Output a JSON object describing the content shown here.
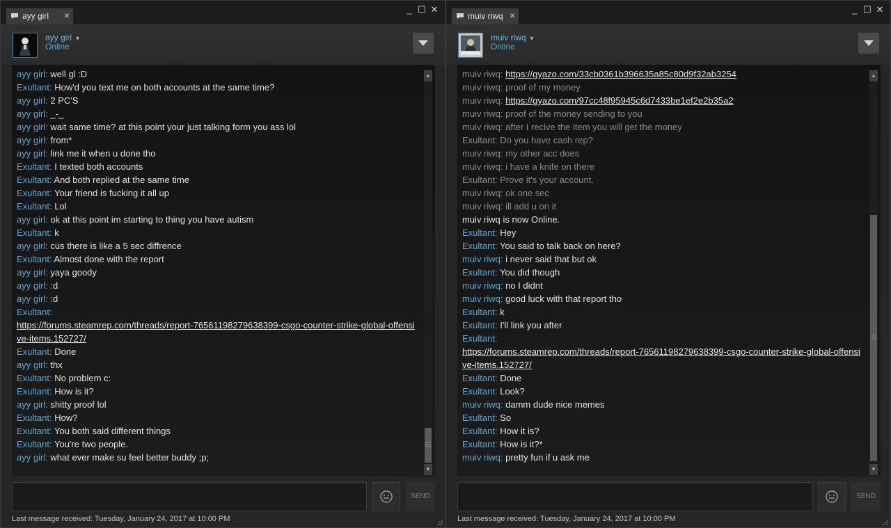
{
  "colors": {
    "accent": "#5aa9d8",
    "window_bg": "#262626",
    "chat_bg": "#141414",
    "old_message": "#8a8a8a"
  },
  "icons": {
    "tab": "chat-bubble-icon",
    "close": "close-icon",
    "minimize": "minimize-icon",
    "maximize": "maximize-icon",
    "menu": "chevron-down-icon",
    "emoji": "emoji-icon",
    "resize": "resize-grip-icon"
  },
  "left": {
    "tab_label": "ayy girl",
    "friend_name": "ayy girl",
    "friend_status": "Online",
    "send_label": "SEND",
    "footer": "Last message received: Tuesday, January 24, 2017 at 10:00 PM",
    "scroll_position": 1.0,
    "messages": [
      {
        "sender": "ayy girl",
        "text": "well gl :D"
      },
      {
        "sender": "Exultant",
        "text": "How'd you text me on both accounts at the same time?"
      },
      {
        "sender": "ayy girl",
        "text": "2 PC'S"
      },
      {
        "sender": "ayy girl",
        "text": "_-_"
      },
      {
        "sender": "ayy girl",
        "text": "wait same time? at this point your just talking form you ass lol"
      },
      {
        "sender": "ayy girl",
        "text": "from*"
      },
      {
        "sender": "ayy girl",
        "text": "link me it when u done tho"
      },
      {
        "sender": "Exultant",
        "text": "I texted both accounts"
      },
      {
        "sender": "Exultant",
        "text": "And both replied at the same time"
      },
      {
        "sender": "Exultant",
        "text": "Your friend is fucking it all up"
      },
      {
        "sender": "Exultant",
        "text": "Lol"
      },
      {
        "sender": "ayy girl",
        "text": "ok  at this point im starting to thing you have autism"
      },
      {
        "sender": "Exultant",
        "text": "k"
      },
      {
        "sender": "ayy girl",
        "text": "cus there is like a 5 sec diffrence"
      },
      {
        "sender": "Exultant",
        "text": "Almost done with the report"
      },
      {
        "sender": "ayy girl",
        "text": "yaya goody"
      },
      {
        "sender": "ayy girl",
        "text": ":d"
      },
      {
        "sender": "ayy girl",
        "text": ":d"
      },
      {
        "sender": "Exultant",
        "text": "",
        "link": "https://forums.steamrep.com/threads/report-76561198279638399-csgo-counter-strike-global-offensive-items.152727/"
      },
      {
        "sender": "Exultant",
        "text": "Done"
      },
      {
        "sender": "ayy girl",
        "text": "thx"
      },
      {
        "sender": "Exultant",
        "text": "No problem c:"
      },
      {
        "sender": "Exultant",
        "text": "How is it?"
      },
      {
        "sender": "ayy girl",
        "text": "shitty proof lol"
      },
      {
        "sender": "Exultant",
        "text": "How?"
      },
      {
        "sender": "Exultant",
        "text": "You both said different things"
      },
      {
        "sender": "Exultant",
        "text": "You're two people."
      },
      {
        "sender": "ayy girl",
        "text": "what ever make su feel better buddy ;p;"
      }
    ]
  },
  "right": {
    "tab_label": "muiv riwq",
    "friend_name": "muiv riwq",
    "friend_status": "Online",
    "send_label": "SEND",
    "footer": "Last message received: Tuesday, January 24, 2017 at 10:00 PM",
    "scroll_position": 1.0,
    "messages": [
      {
        "sender": "muiv riwq",
        "text": "",
        "link": "https://gyazo.com/33cb0361b396635a85c80d9f32ab3254",
        "old": true
      },
      {
        "sender": "muiv riwq",
        "text": "proof of my money",
        "old": true
      },
      {
        "sender": "muiv riwq",
        "text": "",
        "link": "https://gyazo.com/97cc48f95945c6d7433be1ef2e2b35a2",
        "old": true
      },
      {
        "sender": "muiv riwq",
        "text": "proof of the money sending to you",
        "old": true
      },
      {
        "sender": "muiv riwq",
        "text": "after I recive the item you will get the money",
        "old": true
      },
      {
        "sender": "Exultant",
        "text": "Do you have cash rep?",
        "old": true
      },
      {
        "sender": "muiv riwq",
        "text": "my other acc does",
        "old": true
      },
      {
        "sender": "muiv riwq",
        "text": "i have a knife on there",
        "old": true
      },
      {
        "sender": "Exultant",
        "text": "Prove it's your account.",
        "old": true
      },
      {
        "sender": "muiv riwq",
        "text": "ok one sec",
        "old": true
      },
      {
        "sender": "muiv riwq",
        "text": "ill add u on it",
        "old": true
      },
      {
        "status": "muiv riwq is now Online."
      },
      {
        "sender": "Exultant",
        "text": "Hey"
      },
      {
        "sender": "Exultant",
        "text": "You said to talk back on here?"
      },
      {
        "sender": "muiv riwq",
        "text": "i never said that but ok"
      },
      {
        "sender": "Exultant",
        "text": "You did though"
      },
      {
        "sender": "muiv riwq",
        "text": "no I didnt"
      },
      {
        "sender": "muiv riwq",
        "text": "good luck with that report tho"
      },
      {
        "sender": "Exultant",
        "text": "k"
      },
      {
        "sender": "Exultant",
        "text": "I'll link you after"
      },
      {
        "sender": "Exultant",
        "text": "",
        "link": "https://forums.steamrep.com/threads/report-76561198279638399-csgo-counter-strike-global-offensive-items.152727/"
      },
      {
        "sender": "Exultant",
        "text": "Done"
      },
      {
        "sender": "Exultant",
        "text": "Look?"
      },
      {
        "sender": "muiv riwq",
        "text": "damm dude nice memes"
      },
      {
        "sender": "Exultant",
        "text": "So"
      },
      {
        "sender": "Exultant",
        "text": "How it is?"
      },
      {
        "sender": "Exultant",
        "text": "How is it?*"
      },
      {
        "sender": "muiv riwq",
        "text": "pretty fun if u ask me"
      }
    ]
  }
}
